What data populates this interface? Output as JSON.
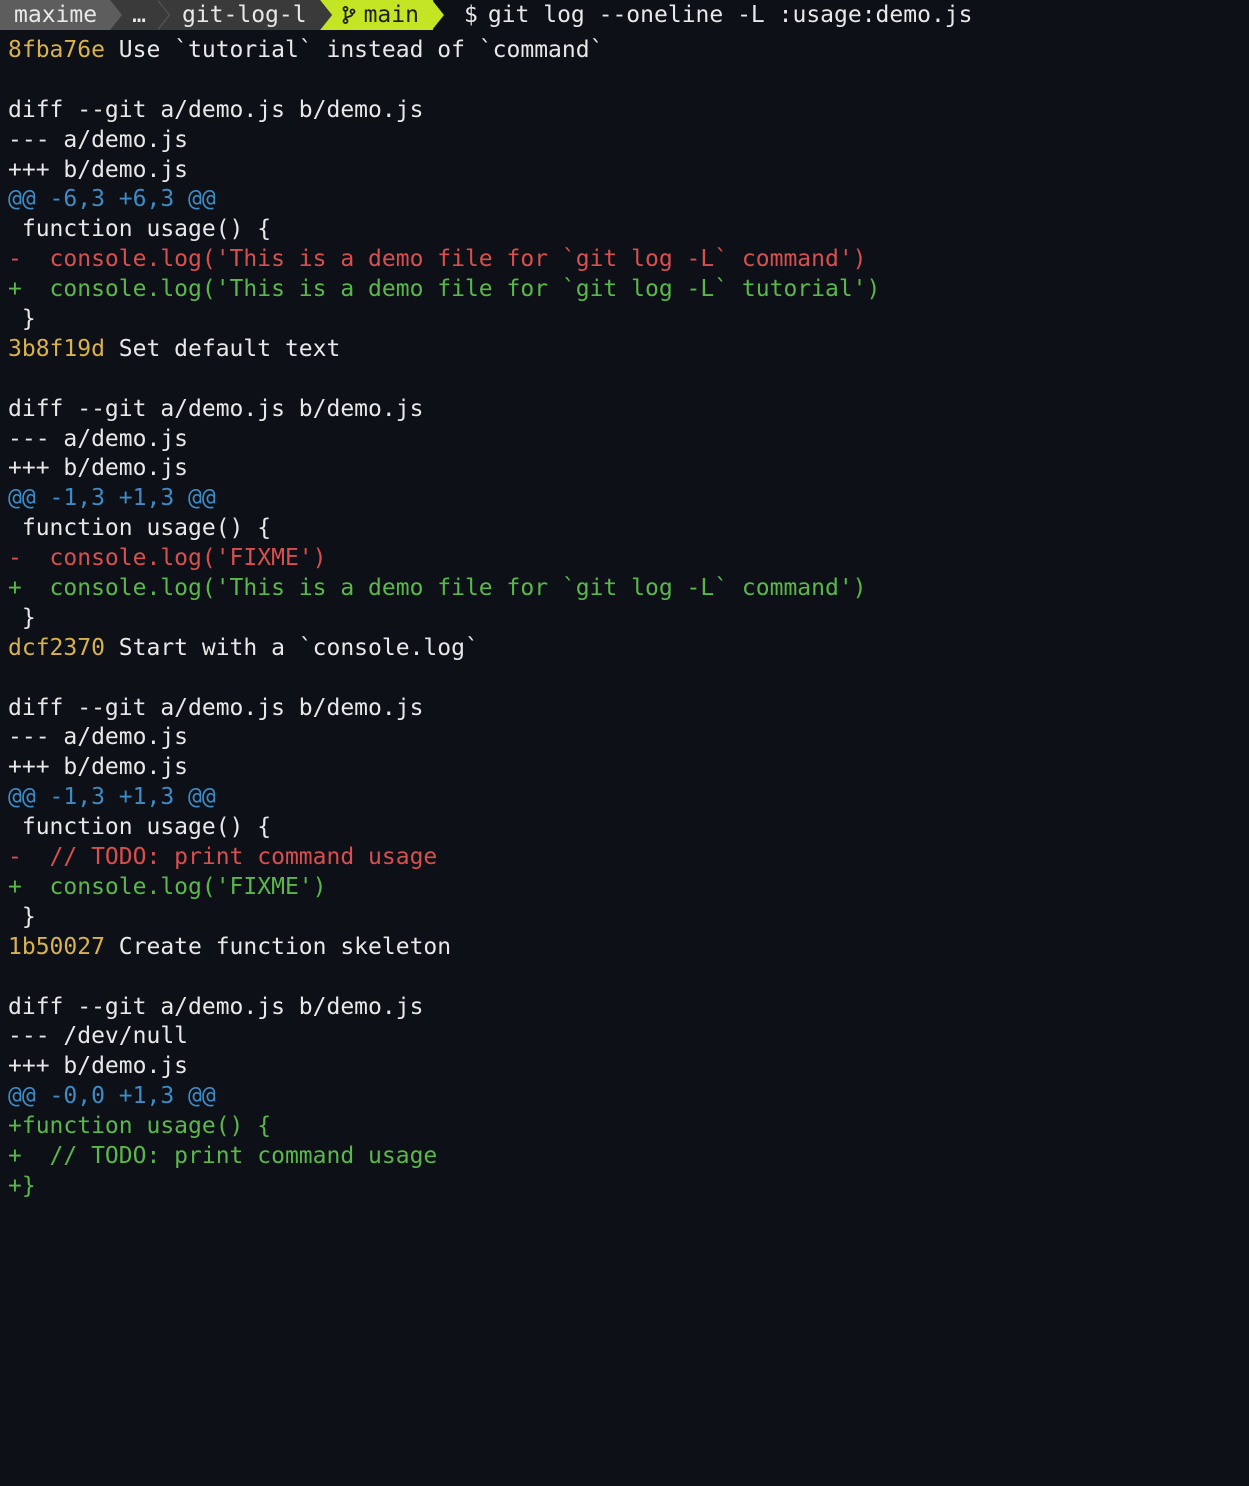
{
  "prompt": {
    "user": "maxime",
    "ellipsis": "…",
    "dir": "git-log-l",
    "branch": "main",
    "symbol": "$",
    "command": "git log --oneline -L :usage:demo.js"
  },
  "commits": [
    {
      "hash": "8fba76e",
      "message": "Use `tutorial` instead of `command`",
      "header": "diff --git a/demo.js b/demo.js",
      "old": "--- a/demo.js",
      "new": "+++ b/demo.js",
      "hunk": "@@ -6,3 +6,3 @@",
      "lines": [
        {
          "t": "ctx",
          "s": " function usage() {"
        },
        {
          "t": "minus",
          "s": "-  console.log('This is a demo file for `git log -L` command')"
        },
        {
          "t": "plus",
          "s": "+  console.log('This is a demo file for `git log -L` tutorial')"
        },
        {
          "t": "ctx",
          "s": " }"
        }
      ]
    },
    {
      "hash": "3b8f19d",
      "message": "Set default text",
      "header": "diff --git a/demo.js b/demo.js",
      "old": "--- a/demo.js",
      "new": "+++ b/demo.js",
      "hunk": "@@ -1,3 +1,3 @@",
      "lines": [
        {
          "t": "ctx",
          "s": " function usage() {"
        },
        {
          "t": "minus",
          "s": "-  console.log('FIXME')"
        },
        {
          "t": "plus",
          "s": "+  console.log('This is a demo file for `git log -L` command')"
        },
        {
          "t": "ctx",
          "s": " }"
        }
      ]
    },
    {
      "hash": "dcf2370",
      "message": "Start with a `console.log`",
      "header": "diff --git a/demo.js b/demo.js",
      "old": "--- a/demo.js",
      "new": "+++ b/demo.js",
      "hunk": "@@ -1,3 +1,3 @@",
      "lines": [
        {
          "t": "ctx",
          "s": " function usage() {"
        },
        {
          "t": "minus",
          "s": "-  // TODO: print command usage"
        },
        {
          "t": "plus",
          "s": "+  console.log('FIXME')"
        },
        {
          "t": "ctx",
          "s": " }"
        }
      ]
    },
    {
      "hash": "1b50027",
      "message": "Create function skeleton",
      "header": "diff --git a/demo.js b/demo.js",
      "old": "--- /dev/null",
      "new": "+++ b/demo.js",
      "hunk": "@@ -0,0 +1,3 @@",
      "lines": [
        {
          "t": "plus",
          "s": "+function usage() {"
        },
        {
          "t": "plus",
          "s": "+  // TODO: print command usage"
        },
        {
          "t": "plus",
          "s": "+}"
        }
      ]
    }
  ]
}
